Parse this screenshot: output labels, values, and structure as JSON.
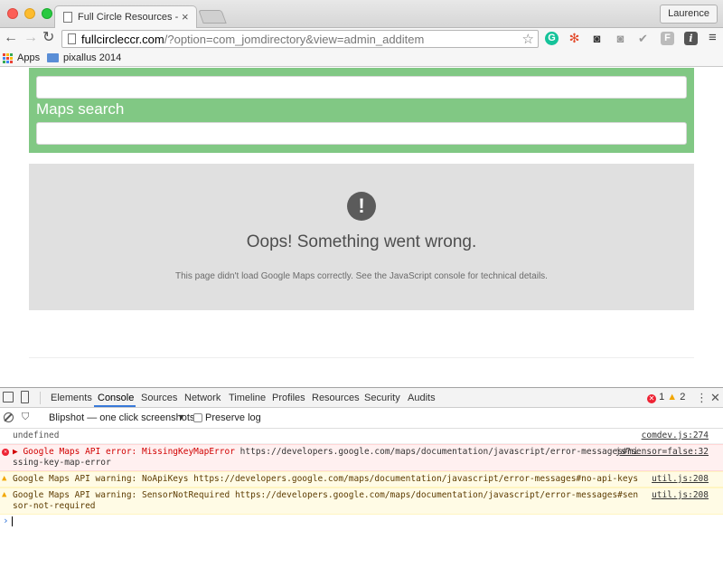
{
  "browser": {
    "tab_title": "Full Circle Resources - Full",
    "tab_close": "×",
    "profile_name": "Laurence",
    "url_domain": "fullcircleccr.com",
    "url_path": "/?option=com_jomdirectory&view=admin_additem",
    "back_glyph": "←",
    "forward_glyph": "→",
    "reload_glyph": "↻",
    "star_glyph": "☆",
    "menu_glyph": "≡",
    "extensions": {
      "grammarly": "G",
      "joomla": "✻",
      "camera1": "◙",
      "camera2": "◙",
      "check": "✔",
      "f": "F",
      "i": "i"
    },
    "bookmarks": {
      "apps_label": "Apps",
      "folder_label": "pixallus 2014",
      "apps_colors": [
        "#ea4335",
        "#fbbc05",
        "#34a853",
        "#4285f4",
        "#ea4335",
        "#fbbc05",
        "#34a853",
        "#4285f4",
        "#ea4335"
      ]
    }
  },
  "page": {
    "maps_search_label": "Maps search",
    "error": {
      "icon_glyph": "!",
      "title": "Oops! Something went wrong.",
      "detail": "This page didn't load Google Maps correctly. See the JavaScript console for technical details."
    }
  },
  "devtools": {
    "tabs": [
      "Elements",
      "Console",
      "Sources",
      "Network",
      "Timeline",
      "Profiles",
      "Resources",
      "Security",
      "Audits"
    ],
    "active_tab": "Console",
    "error_count": "1",
    "warning_count": "2",
    "menu_glyph": "⋮",
    "close_glyph": "✕",
    "filter_glyph": "⛉",
    "context_label": "Blipshot — one click screenshots",
    "context_arrow": "▼",
    "preserve_log_label": "Preserve log",
    "console_rows": [
      {
        "level": "log",
        "message": "undefined",
        "source": "comdev.js:274"
      },
      {
        "level": "error",
        "prefix": "▶ Google Maps API error: MissingKeyMapError",
        "message": " https://developers.google.com/maps/documentation/javascript/error-messages#missing-key-map-error",
        "source": "js?sensor=false:32"
      },
      {
        "level": "warning",
        "message": "Google Maps API warning: NoApiKeys https://developers.google.com/maps/documentation/javascript/error-messages#no-api-keys",
        "source": "util.js:208"
      },
      {
        "level": "warning",
        "message": "Google Maps API warning: SensorNotRequired https://developers.google.com/maps/documentation/javascript/error-messages#sensor-not-required",
        "source": "util.js:208"
      }
    ],
    "prompt_glyph": "›"
  },
  "colors": {
    "green_panel": "#81c884",
    "error_red": "#d10000",
    "warning_amber": "#f2a600",
    "devtools_accent": "#3879d9"
  }
}
